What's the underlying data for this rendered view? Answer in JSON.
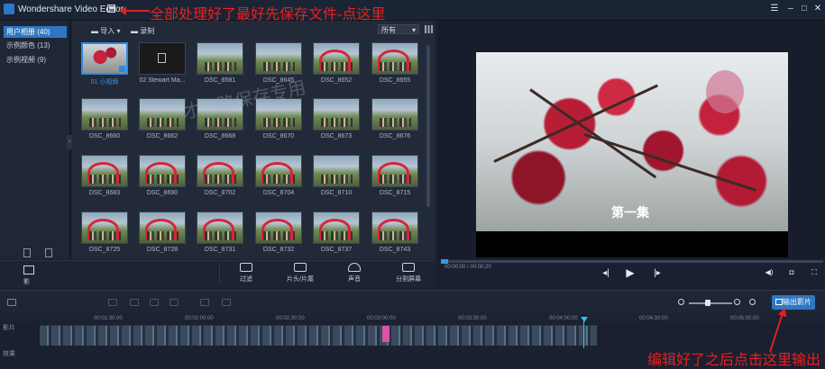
{
  "app": {
    "title": "Wondershare Video Editor"
  },
  "annotations": {
    "top": "全部处理好了最好先保存文件-点这里",
    "bottom": "编辑好了之后点击这里输出",
    "watermark": "才之路保存专用"
  },
  "categories": [
    {
      "label": "用户相册 (40)",
      "selected": true
    },
    {
      "label": "示例颜色 (13)",
      "selected": false
    },
    {
      "label": "示例视频 (9)",
      "selected": false
    }
  ],
  "media_toolbar": {
    "import_label": "导入",
    "record_label": "录制",
    "filter_value": "所有"
  },
  "media_items": [
    {
      "label": "01 小视频",
      "style": "flower",
      "selected": true
    },
    {
      "label": "02 Stewart Ma...",
      "style": "dark",
      "selected": false
    },
    {
      "label": "DSC_8581",
      "style": "riders"
    },
    {
      "label": "DSC_8645",
      "style": "riders"
    },
    {
      "label": "DSC_8652",
      "style": "arch"
    },
    {
      "label": "DSC_8655",
      "style": "arch"
    },
    {
      "label": "DSC_8660",
      "style": "riders"
    },
    {
      "label": "DSC_8662",
      "style": "riders"
    },
    {
      "label": "DSC_8668",
      "style": "riders"
    },
    {
      "label": "DSC_8670",
      "style": "riders"
    },
    {
      "label": "DSC_8673",
      "style": "riders"
    },
    {
      "label": "DSC_8676",
      "style": "riders"
    },
    {
      "label": "DSC_8683",
      "style": "arch"
    },
    {
      "label": "DSC_8690",
      "style": "arch"
    },
    {
      "label": "DSC_8702",
      "style": "arch"
    },
    {
      "label": "DSC_8704",
      "style": "arch"
    },
    {
      "label": "DSC_8710",
      "style": "riders"
    },
    {
      "label": "DSC_8715",
      "style": "arch"
    },
    {
      "label": "DSC_8725",
      "style": "arch"
    },
    {
      "label": "DSC_8728",
      "style": "arch"
    },
    {
      "label": "DSC_8731",
      "style": "arch"
    },
    {
      "label": "DSC_8732",
      "style": "arch"
    },
    {
      "label": "DSC_8737",
      "style": "arch"
    },
    {
      "label": "DSC_8743",
      "style": "arch"
    }
  ],
  "tools": [
    {
      "label": "过滤",
      "icon": "filter-icon"
    },
    {
      "label": "片头/片尾",
      "icon": "title-icon"
    },
    {
      "label": "声音",
      "icon": "headphones-icon"
    },
    {
      "label": "分割屏幕",
      "icon": "split-screen-icon"
    }
  ],
  "left_strip_label": "影",
  "preview": {
    "subtitle": "第一集",
    "timecode": "00:00:00 / 00:00:20",
    "progress": 0.02
  },
  "timeline": {
    "export_label": "输出影片",
    "ruler": [
      "00:01:30:00",
      "00:02:00:00",
      "00:02:30:00",
      "00:03:00:00",
      "00:03:30:00",
      "00:04:00:00",
      "00:04:30:00",
      "00:05:00:00"
    ],
    "video_track_label": "影片",
    "effect_track_label": "效果"
  }
}
